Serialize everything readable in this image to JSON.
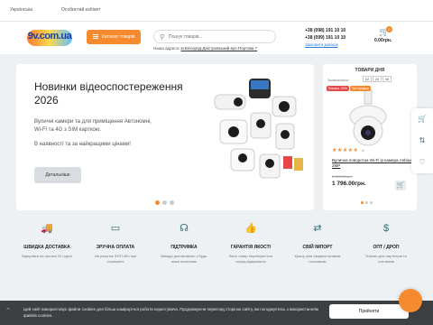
{
  "topbar": {
    "language": "Українська",
    "account": "Особистий кабінет"
  },
  "header": {
    "logo_text": "9v.com.ua",
    "catalog_label": "Каталог товарів",
    "search_placeholder": "Пошук товарів...",
    "address_prefix": "Наша адреса:",
    "address_link": "м.Білгород-Дністровський вул.Портова 7",
    "phone1": "+38 (098) 191 10 10",
    "phone2": "+38 (099) 191 10 10",
    "callback": "Замовити дзвінок",
    "cart_count": "0",
    "cart_total": "0.00грн."
  },
  "banner": {
    "title": "Новинки відеоспостереження 2026",
    "description": "Вуличні камери та для приміщення Автономні, Wi-Fi та 4G з SIM карткою.",
    "stock_note": "В наявності та за найкращими цінами!",
    "more_label": "Детальніше"
  },
  "day_product": {
    "title": "ТОВАРИ ДНЯ",
    "remaining_label": "Залишилось:",
    "timer": [
      "22",
      "23",
      "46"
    ],
    "tag_a": "Знижка -20%",
    "tag_b": "Топ продаж",
    "stars": "★★★★★",
    "reviews": "0",
    "name": "Вулична поворотна Wi-Fi ip камера Anbiux 2MP",
    "old_price": "2 245.00грн.",
    "price": "1 796.00грн.",
    "cart_icon": "cart-icon"
  },
  "features": [
    {
      "icon": "truck",
      "title": "ШВИДКА ДОСТАВКА",
      "desc": "Відправка на протязі 24 годин"
    },
    {
      "icon": "card",
      "title": "ЗРУЧНА ОПЛАТА",
      "desc": "На рахунок ФОП або при отриманні"
    },
    {
      "icon": "headset",
      "title": "ПІДТРИМКА",
      "desc": "Завжди допоможемо з будь-яким питанням"
    },
    {
      "icon": "thumb",
      "title": "ГАРАНТІЯ ЯКОСТІ",
      "desc": "Весь товар перевіряється перед відправкою"
    },
    {
      "icon": "import",
      "title": "СВІЙ ІМПОРТ",
      "desc": "Кращі ціни завдяки прямим поставкам"
    },
    {
      "icon": "dollar",
      "title": "ОПТ / ДРОП",
      "desc": "Знижки для партнерів та оптовиків"
    }
  ],
  "cookie": {
    "message": "Цей сайт використовує файли cookies для більш комфортної роботи користувача. Продовжуючи перегляд сторінок сайту, ви погоджуєтесь з використанням файлів cookies.",
    "accept_label": "Прийняти"
  }
}
